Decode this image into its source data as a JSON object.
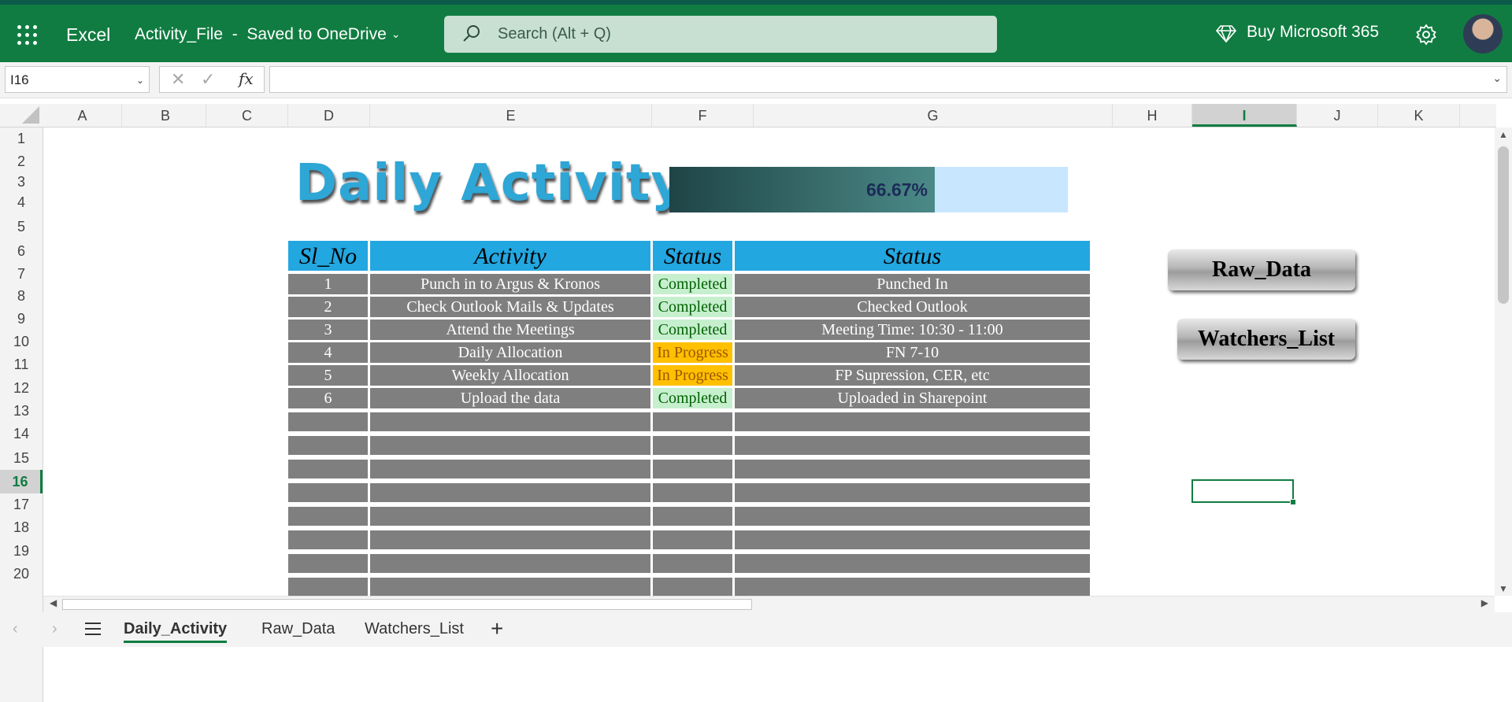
{
  "app": {
    "name": "Excel",
    "file_title": "Activity_File  -  Saved to OneDrive",
    "search_placeholder": "Search (Alt + Q)",
    "buy_label": "Buy Microsoft 365",
    "brand_color": "#107c41"
  },
  "formula_bar": {
    "name_box": "I16",
    "formula": "",
    "fx_label": "fx"
  },
  "columns": [
    "A",
    "B",
    "C",
    "D",
    "E",
    "F",
    "G",
    "H",
    "I",
    "J",
    "K"
  ],
  "selected_column": "I",
  "rows": [
    "1",
    "2",
    "3",
    "4",
    "5",
    "6",
    "7",
    "8",
    "9",
    "10",
    "11",
    "12",
    "13",
    "14",
    "15",
    "16",
    "17",
    "18",
    "19",
    "20"
  ],
  "selected_row": "16",
  "sheet": {
    "title": "Daily Activity",
    "progress": {
      "value": 0.6667,
      "label": "66.67%"
    },
    "table": {
      "headers": [
        "Sl_No",
        "Activity",
        "Status",
        "Status"
      ],
      "rows": [
        [
          "1",
          "Punch in to Argus & Kronos",
          "Completed",
          "Punched In"
        ],
        [
          "2",
          "Check Outlook Mails & Updates",
          "Completed",
          "Checked Outlook"
        ],
        [
          "3",
          "Attend the Meetings",
          "Completed",
          "Meeting Time: 10:30 - 11:00"
        ],
        [
          "4",
          "Daily Allocation",
          "In Progress",
          "FN 7-10"
        ],
        [
          "5",
          "Weekly Allocation",
          "In Progress",
          "FP Supression, CER, etc"
        ],
        [
          "6",
          "Upload the data",
          "Completed",
          "Uploaded in Sharepoint"
        ]
      ],
      "empty_rows": 8
    },
    "buttons": [
      "Raw_Data",
      "Watchers_List"
    ]
  },
  "tabs": [
    "Daily_Activity",
    "Raw_Data",
    "Watchers_List"
  ],
  "active_tab": "Daily_Activity",
  "colors": {
    "header_blue": "#22a7e1",
    "cell_gray": "#7f7f7f",
    "completed_bg": "#c6efce",
    "in_progress_bg": "#ffc000"
  }
}
